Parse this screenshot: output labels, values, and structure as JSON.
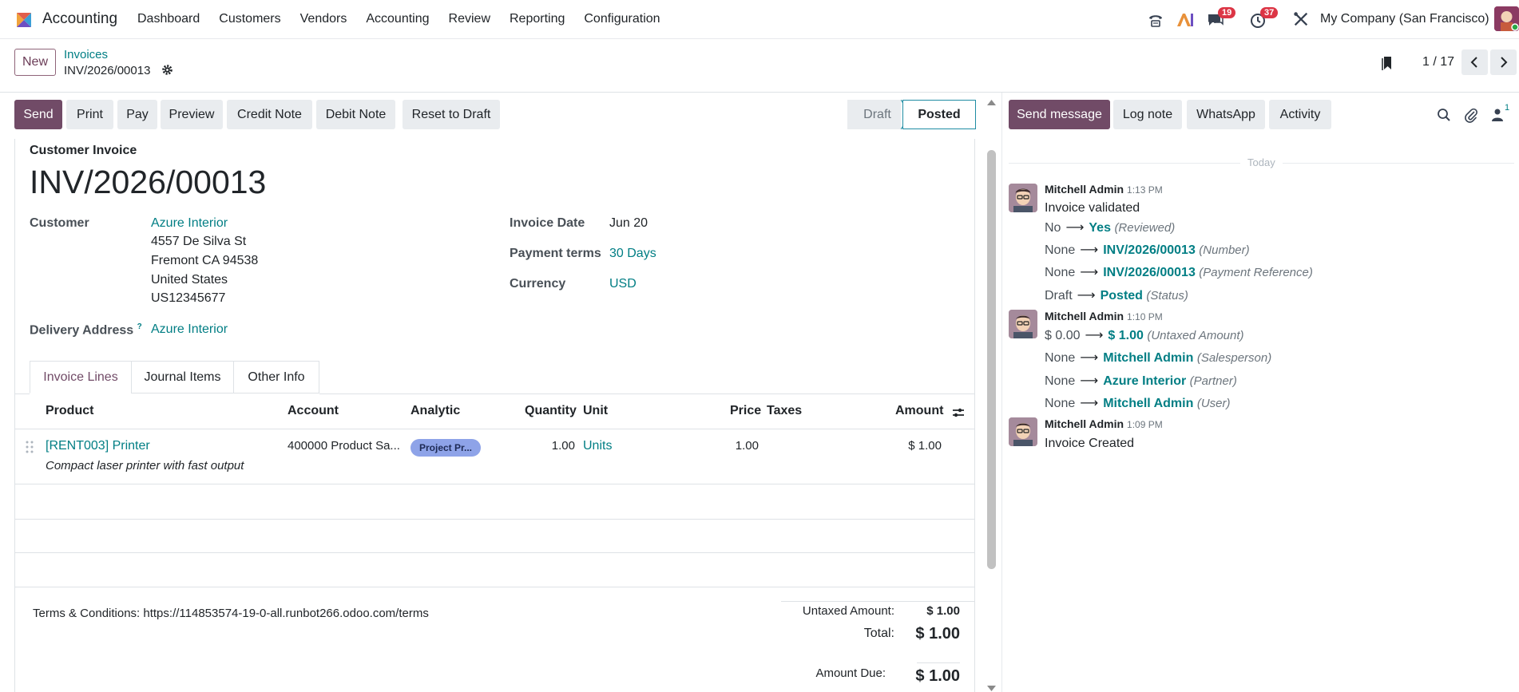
{
  "navbar": {
    "app_name": "Accounting",
    "menu": [
      "Dashboard",
      "Customers",
      "Vendors",
      "Accounting",
      "Review",
      "Reporting",
      "Configuration"
    ],
    "messages_badge": "19",
    "activities_badge": "37",
    "company": "My Company (San Francisco)"
  },
  "control": {
    "new_label": "New",
    "breadcrumb_parent": "Invoices",
    "breadcrumb_current": "INV/2026/00013",
    "pager": "1 / 17"
  },
  "actions": [
    "Send",
    "Print",
    "Pay",
    "Preview",
    "Credit Note",
    "Debit Note",
    "Reset to Draft"
  ],
  "status": {
    "draft": "Draft",
    "posted": "Posted"
  },
  "invoice": {
    "type": "Customer Invoice",
    "number": "INV/2026/00013",
    "customer_label": "Customer",
    "customer_name": "Azure Interior",
    "address": [
      "4557 De Silva St",
      "Fremont CA 94538",
      "United States",
      "US12345677"
    ],
    "delivery_label": "Delivery Address",
    "delivery_help": "?",
    "delivery_value": "Azure Interior",
    "date_label": "Invoice Date",
    "date_value": "Jun 20",
    "terms_label": "Payment terms",
    "terms_value": "30 Days",
    "currency_label": "Currency",
    "currency_value": "USD"
  },
  "tabs": [
    "Invoice Lines",
    "Journal Items",
    "Other Info"
  ],
  "lines": {
    "headers": {
      "product": "Product",
      "account": "Account",
      "analytic": "Analytic",
      "quantity": "Quantity",
      "unit": "Unit",
      "price": "Price",
      "taxes": "Taxes",
      "amount": "Amount"
    },
    "rows": [
      {
        "product": "[RENT003] Printer",
        "description": "Compact laser printer with fast output",
        "account": "400000 Product Sa...",
        "analytic": "Project Pr...",
        "quantity": "1.00",
        "unit": "Units",
        "price": "1.00",
        "amount": "$ 1.00"
      }
    ]
  },
  "footer": {
    "terms": "Terms & Conditions: https://114853574-19-0-all.runbot266.odoo.com/terms",
    "untaxed_label": "Untaxed Amount:",
    "untaxed_value": "$ 1.00",
    "total_label": "Total:",
    "total_value": "$ 1.00",
    "due_label": "Amount Due:",
    "due_value": "$ 1.00"
  },
  "chatter": {
    "buttons": [
      "Send message",
      "Log note",
      "WhatsApp",
      "Activity"
    ],
    "followers_count": "1",
    "today": "Today",
    "messages": [
      {
        "author": "Mitchell Admin",
        "time": "1:13 PM",
        "body": "Invoice validated",
        "tracking": [
          {
            "old": "No",
            "new": "Yes",
            "field": "(Reviewed)"
          },
          {
            "old": "None",
            "new": "INV/2026/00013",
            "field": "(Number)"
          },
          {
            "old": "None",
            "new": "INV/2026/00013",
            "field": "(Payment Reference)"
          },
          {
            "old": "Draft",
            "new": "Posted",
            "field": "(Status)"
          }
        ]
      },
      {
        "author": "Mitchell Admin",
        "time": "1:10 PM",
        "body": "",
        "tracking": [
          {
            "old": "$ 0.00",
            "new": "$ 1.00",
            "field": "(Untaxed Amount)"
          },
          {
            "old": "None",
            "new": "Mitchell Admin",
            "field": "(Salesperson)"
          },
          {
            "old": "None",
            "new": "Azure Interior",
            "field": "(Partner)"
          },
          {
            "old": "None",
            "new": "Mitchell Admin",
            "field": "(User)"
          }
        ]
      },
      {
        "author": "Mitchell Admin",
        "time": "1:09 PM",
        "body": "Invoice Created",
        "tracking": []
      }
    ]
  },
  "colors": {
    "primary": "#714b67",
    "link": "#017e84",
    "badge": "#dc3545"
  }
}
